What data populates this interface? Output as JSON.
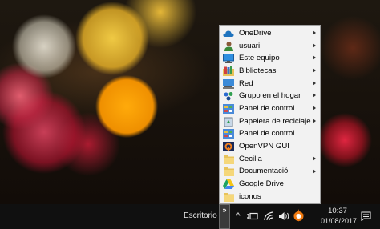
{
  "menu": {
    "items": [
      {
        "label": "OneDrive",
        "icon": "onedrive-cloud-icon",
        "submenu": true
      },
      {
        "label": "usuari",
        "icon": "user-folder-icon",
        "submenu": true
      },
      {
        "label": "Este equipo",
        "icon": "computer-icon",
        "submenu": true
      },
      {
        "label": "Bibliotecas",
        "icon": "libraries-icon",
        "submenu": true
      },
      {
        "label": "Red",
        "icon": "network-icon",
        "submenu": true
      },
      {
        "label": "Grupo en el hogar",
        "icon": "homegroup-icon",
        "submenu": true
      },
      {
        "label": "Panel de control",
        "icon": "control-panel-icon",
        "submenu": true
      },
      {
        "label": "Papelera de reciclaje",
        "icon": "recycle-bin-icon",
        "submenu": true
      },
      {
        "label": "Panel de control",
        "icon": "control-panel-icon",
        "submenu": false
      },
      {
        "label": "OpenVPN GUI",
        "icon": "openvpn-icon",
        "submenu": false
      },
      {
        "label": "Cecilia",
        "icon": "folder-icon",
        "submenu": true
      },
      {
        "label": "Documentació",
        "icon": "folder-icon",
        "submenu": true
      },
      {
        "label": "Google Drive",
        "icon": "google-drive-icon",
        "submenu": false
      },
      {
        "label": "iconos",
        "icon": "folder-icon",
        "submenu": false
      }
    ]
  },
  "taskbar": {
    "desktop_label": "Escritorio",
    "chevron": "»",
    "tray": {
      "show_hidden_symbol": "^",
      "icons": [
        "battery-plug-icon",
        "wifi-icon",
        "volume-icon",
        "avast-icon"
      ]
    },
    "clock": {
      "time": "10:37",
      "date": "01/08/2017"
    },
    "notification_icon": "action-center-icon"
  },
  "colors": {
    "menu_bg": "#f2f2f2",
    "taskbar_bg": "#101010",
    "accent_blue": "#1e73be"
  }
}
